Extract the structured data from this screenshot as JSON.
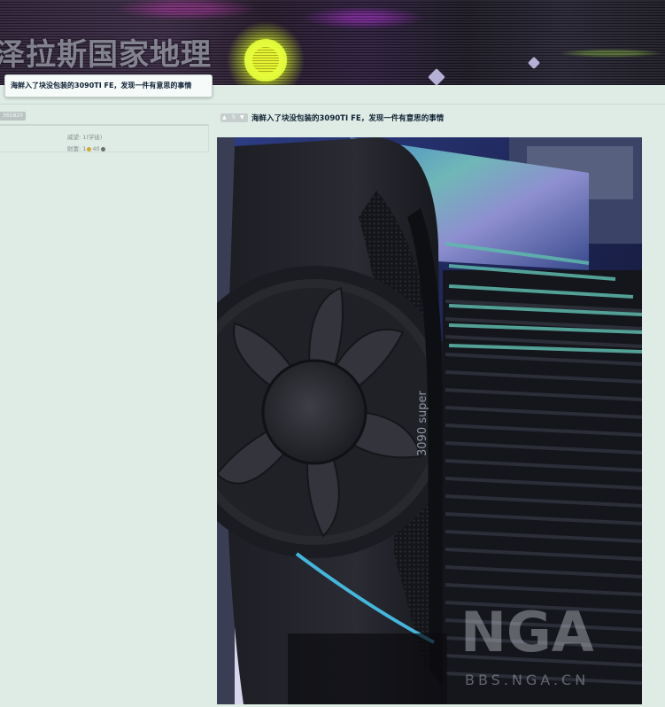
{
  "banner": {
    "site_title": "泽拉斯国家地理"
  },
  "thread": {
    "tooltip_title": "海鲜入了块没包装的3090TI FE，发现一件有意思的事情"
  },
  "author": {
    "uid_badge": "365820",
    "weight_label": "威望: 1(学徒)",
    "wealth_prefix": "财富: 1",
    "wealth_gold": "",
    "wealth_silver": "40"
  },
  "post": {
    "rate_count": "5",
    "title": "海鲜入了块没包装的3090TI FE，发现一件有意思的事情",
    "image": {
      "card_label": "3090 super",
      "watermark_logo": "NGA",
      "watermark_url": "BBS.NGA.CN"
    }
  },
  "colors": {
    "page_bg": "#dfece6",
    "title_text": "#0e2031",
    "muted_text": "#7f8e8c",
    "badge_bg": "#b9c3c2"
  }
}
